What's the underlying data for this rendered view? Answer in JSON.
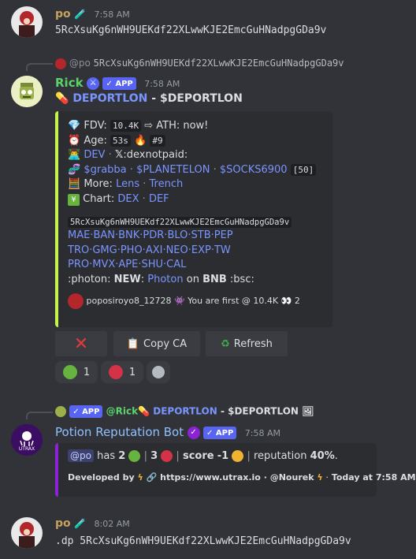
{
  "msg1": {
    "username": "po",
    "time": "7:58 AM",
    "text": "5RcXsuKg6nWH9UEKdf22XLwwKJE2EmcGuHNadpgGDa9v"
  },
  "msg2": {
    "reply_author": "@po",
    "reply_text": "5RcXsuKg6nWH9UEKdf22XLwwKJE2EmcGuHNadpgGDa9v",
    "username": "Rick",
    "app_badge": "APP",
    "time": "7:58 AM",
    "title_link": "DEPORTLON",
    "title_rest": " - $DEPORTLON",
    "embed": {
      "fdv_label": "FDV:",
      "fdv_value": "10.4K",
      "ath_text": "⇨ ATH: now!",
      "age_label": "Age:",
      "age_value": "53s",
      "age_rank": "#9",
      "dev_link": "DEV",
      "dev_text": ":dexnotpaid:",
      "social_1": "$grabba",
      "social_2": "$PLANETELON",
      "social_3": "$SOCKS6900",
      "social_count": "[50]",
      "more_label": "More:",
      "more_1": "Lens",
      "more_2": "Trench",
      "chart_label": "Chart:",
      "chart_1": "DEX",
      "chart_2": "DEF",
      "address": "5RcXsuKg6nWH9UEKdf22XLwwKJE2EmcGuHNadpgGDa9v",
      "platforms_row1": "MAE·BAN·BNK·PDR·BLO·STB·PEP",
      "platforms_row2": "TRO·GMG·PHO·AXI·NEO·EXP·TW",
      "platforms_row3": "PRO·MVX·APE·SHU·CAL",
      "photon_prefix": ":photon:",
      "photon_new": "NEW",
      "photon_link": "Photon",
      "photon_on": "on",
      "photon_chain": "BNB",
      "photon_suffix": ":bsc:",
      "footer_user": "poposiroyo8_12728",
      "footer_text": "You are first @ 10.4K",
      "footer_count": "2"
    },
    "buttons": {
      "close_label": "✕",
      "copy_label": "Copy CA",
      "refresh_label": "Refresh"
    },
    "reactions": {
      "green_count": "1",
      "red_count": "1"
    }
  },
  "msg3": {
    "reply_app": "APP",
    "reply_author": "@Rick",
    "reply_title_link": "DEPORTLON",
    "reply_title_rest": " - $DEPORTLON",
    "username": "Potion Reputation Bot",
    "app_badge": "APP",
    "time": "7:58 AM",
    "embed": {
      "mention": "@po",
      "has": "has",
      "count_green": "2",
      "count_red": "3",
      "score_label": "score",
      "score_value": "-1",
      "reputation_label": "reputation",
      "reputation_value": "40%",
      "footer_dev": "Developed by",
      "footer_url": "https://www.utrax.io",
      "footer_sep": "·",
      "footer_author": "@Nourek",
      "footer_time": "Today at 7:58 AM"
    },
    "avatar_text": "UTRAX"
  },
  "msg4": {
    "username": "po",
    "time": "8:02 AM",
    "text": ".dp 5RcXsuKg6nWH9UEKdf22XLwwKJE2EmcGuHNadpgGDa9v"
  },
  "colors": {
    "background": "#313338",
    "embed_bg": "#2b2d31",
    "rick_name": "#5bd36b",
    "po_name": "#c5a25b",
    "bot_name": "#8fc1ff",
    "link": "#7b95ff",
    "embed_bar_green": "#c6f24c",
    "embed_bar_purple": "#8a23d6"
  }
}
